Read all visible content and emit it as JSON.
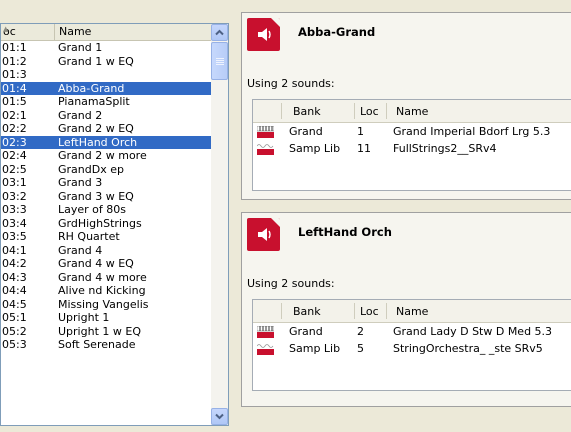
{
  "list": {
    "headers": {
      "loc": "oc",
      "name": "Name"
    },
    "rows": [
      {
        "loc": "01:1",
        "name": "Grand 1"
      },
      {
        "loc": "01:2",
        "name": "Grand 1 w EQ"
      },
      {
        "loc": "01:3",
        "name": ""
      },
      {
        "loc": "01:4",
        "name": "Abba-Grand",
        "selected": true
      },
      {
        "loc": "01:5",
        "name": "PianamaSplit"
      },
      {
        "loc": "02:1",
        "name": "Grand 2"
      },
      {
        "loc": "02:2",
        "name": "Grand 2 w EQ"
      },
      {
        "loc": "02:3",
        "name": "LeftHand Orch",
        "selected": true
      },
      {
        "loc": "02:4",
        "name": "Grand 2 w more"
      },
      {
        "loc": "02:5",
        "name": "GrandDx ep"
      },
      {
        "loc": "03:1",
        "name": "Grand 3"
      },
      {
        "loc": "03:2",
        "name": "Grand 3 w EQ"
      },
      {
        "loc": "03:3",
        "name": "Layer of 80s"
      },
      {
        "loc": "03:4",
        "name": "GrdHighStrings"
      },
      {
        "loc": "03:5",
        "name": "RH Quartet"
      },
      {
        "loc": "04:1",
        "name": "Grand 4"
      },
      {
        "loc": "04:2",
        "name": "Grand 4 w EQ"
      },
      {
        "loc": "04:3",
        "name": "Grand 4 w more"
      },
      {
        "loc": "04:4",
        "name": "Alive nd Kicking"
      },
      {
        "loc": "04:5",
        "name": "Missing Vangelis"
      },
      {
        "loc": "05:1",
        "name": "Upright 1"
      },
      {
        "loc": "05:2",
        "name": "Upright 1 w EQ"
      },
      {
        "loc": "05:3",
        "name": "Soft Serenade"
      }
    ]
  },
  "panels": [
    {
      "title": "Abba-Grand",
      "using": "Using 2 sounds:",
      "columns": {
        "bank": "Bank",
        "loc": "Loc",
        "name": "Name"
      },
      "sounds": [
        {
          "icon": "piano-sound-icon",
          "bank": "Grand",
          "loc": "1",
          "name": "Grand Imperial Bdorf Lrg 5.3"
        },
        {
          "icon": "sample-sound-icon",
          "bank": "Samp Lib",
          "loc": "11",
          "name": "FullStrings2__SRv4"
        }
      ]
    },
    {
      "title": "LeftHand Orch",
      "using": "Using 2 sounds:",
      "columns": {
        "bank": "Bank",
        "loc": "Loc",
        "name": "Name"
      },
      "sounds": [
        {
          "icon": "piano-sound-icon",
          "bank": "Grand",
          "loc": "2",
          "name": "Grand Lady D  Stw D  Med 5.3"
        },
        {
          "icon": "sample-sound-icon",
          "bank": "Samp Lib",
          "loc": "5",
          "name": "StringOrchestra_ _ste SRv5"
        }
      ]
    }
  ],
  "colors": {
    "selection": "#316ac5",
    "accent_red": "#c8102e",
    "scrollbar": "#b8cdf8"
  }
}
